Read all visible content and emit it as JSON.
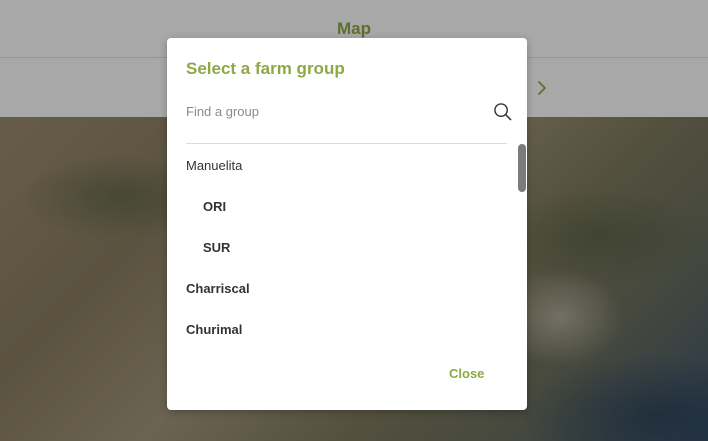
{
  "header": {
    "title": "Map"
  },
  "subbar": {
    "next_icon": "chevron-right-icon"
  },
  "modal": {
    "title": "Select a farm group",
    "search": {
      "placeholder": "Find a group",
      "value": "",
      "icon": "search-icon"
    },
    "groups": [
      {
        "label": "Manuelita",
        "level": 0,
        "bold": false
      },
      {
        "label": "ORI",
        "level": 1,
        "bold": true
      },
      {
        "label": "SUR",
        "level": 1,
        "bold": true
      },
      {
        "label": "Charriscal",
        "level": 0,
        "bold": true
      },
      {
        "label": "Churimal",
        "level": 0,
        "bold": true
      }
    ],
    "close_label": "Close"
  },
  "colors": {
    "accent": "#8fa845",
    "text": "#333333",
    "placeholder": "#8a8a8a",
    "scrollbar": "#7b7b7b"
  }
}
